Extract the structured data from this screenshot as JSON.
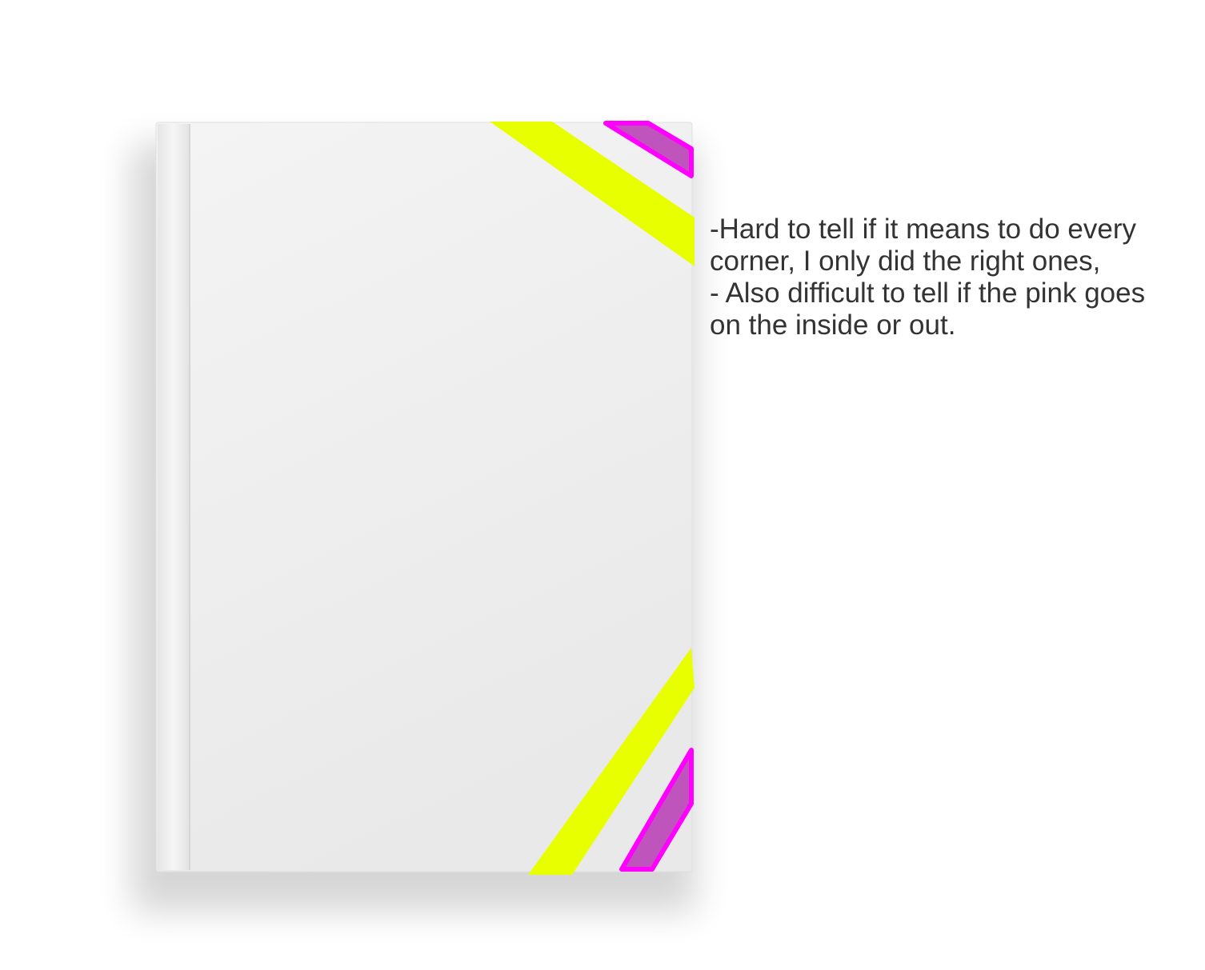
{
  "colors": {
    "highlight_yellow": "#e8ff00",
    "highlight_pink_outline": "#ff00ff",
    "highlight_pink_fill": "#c054bd",
    "book_cover": "#efefef",
    "text": "#333333"
  },
  "note": {
    "lines": [
      "-Hard to tell if it means to do every",
      "corner, I only did the right ones,",
      "- Also difficult to tell if the pink goes",
      "on the inside or out."
    ]
  }
}
